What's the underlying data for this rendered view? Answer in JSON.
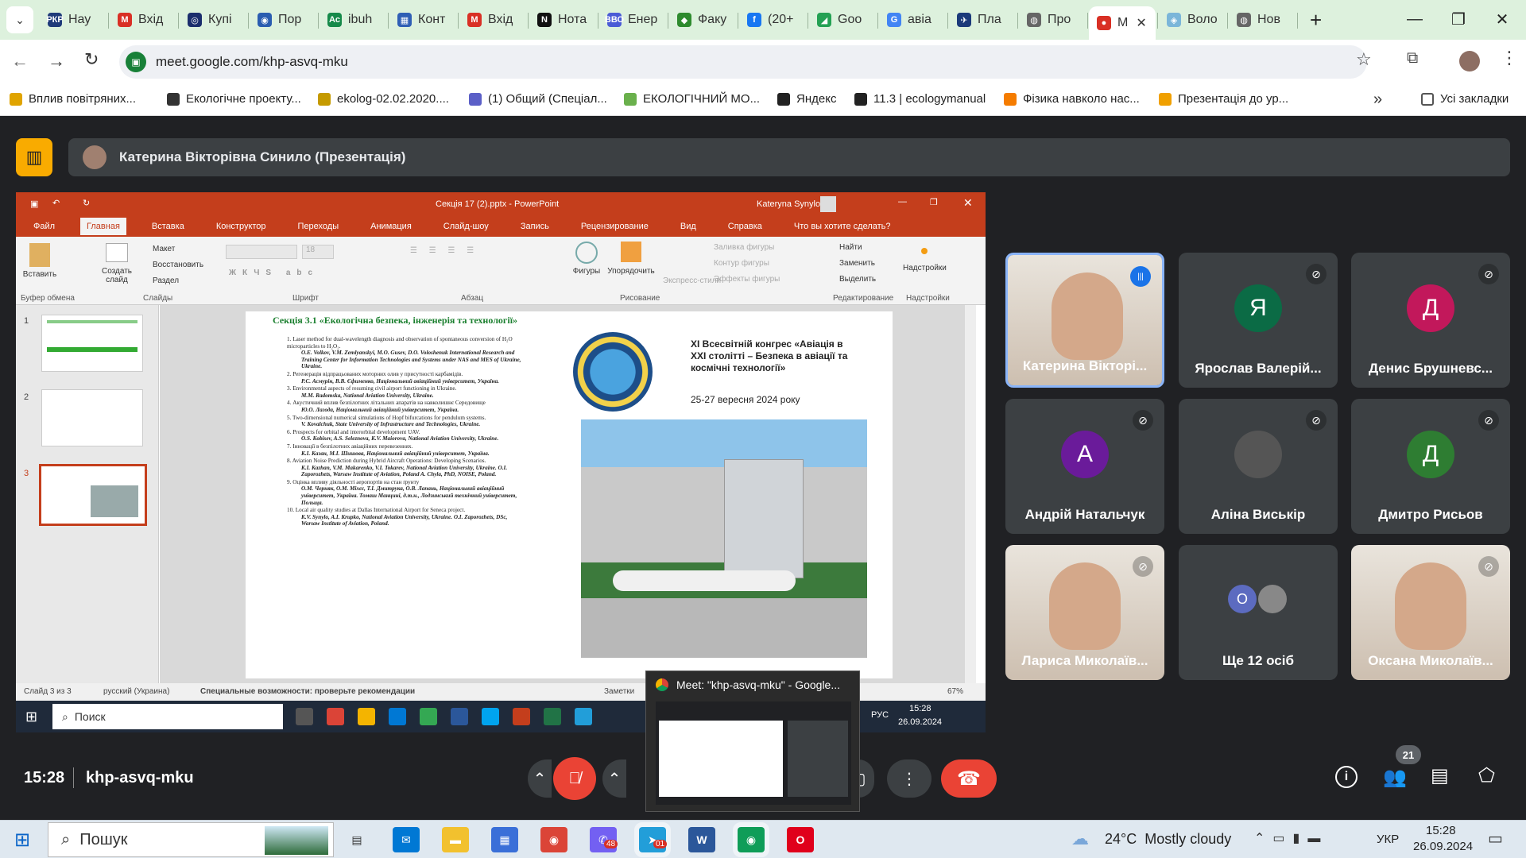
{
  "browser": {
    "tabs": [
      {
        "label": "Нау",
        "fav": "РКР",
        "color": "#1f3b7a"
      },
      {
        "label": "Вхід",
        "fav": "M",
        "color": "#d93025"
      },
      {
        "label": "Купі",
        "fav": "◎",
        "color": "#1b2e6d"
      },
      {
        "label": "Пор",
        "fav": "◉",
        "color": "#2a5db0"
      },
      {
        "label": "ibuh",
        "fav": "Ac",
        "color": "#168a4a"
      },
      {
        "label": "Конт",
        "fav": "▦",
        "color": "#2f5fb5"
      },
      {
        "label": "Вхід",
        "fav": "M",
        "color": "#d93025"
      },
      {
        "label": "Нота",
        "fav": "N",
        "color": "#111"
      },
      {
        "label": "Енер",
        "fav": "ВВО",
        "color": "#4a5bd6"
      },
      {
        "label": "Факу",
        "fav": "◆",
        "color": "#2e8b2e"
      },
      {
        "label": "(20+",
        "fav": "f",
        "color": "#1877f2"
      },
      {
        "label": "Goo",
        "fav": "◢",
        "color": "#24a153"
      },
      {
        "label": "авіа",
        "fav": "G",
        "color": "#4285f4"
      },
      {
        "label": "Пла",
        "fav": "✈",
        "color": "#1b3a7a"
      },
      {
        "label": "Про",
        "fav": "◍",
        "color": "#666"
      },
      {
        "label": "M",
        "fav": "●",
        "color": "#d93025"
      },
      {
        "label": "Воло",
        "fav": "◈",
        "color": "#7bb6d9"
      },
      {
        "label": "Нов",
        "fav": "◍",
        "color": "#666"
      }
    ],
    "url": "meet.google.com/khp-asvq-mku",
    "bookmarks": [
      {
        "label": "Вплив повітряних...",
        "color": "#e0a400"
      },
      {
        "label": "Екологічне проекту...",
        "color": "#333"
      },
      {
        "label": "ekolog-02.02.2020....",
        "color": "#c59a00"
      },
      {
        "label": "(1) Общий (Спеціал...",
        "color": "#5b5fc7"
      },
      {
        "label": "ЕКОЛОГІЧНИЙ МО...",
        "color": "#6ab04c"
      },
      {
        "label": "Яндекс",
        "color": "#222"
      },
      {
        "label": "11.3 | ecologymanual",
        "color": "#222"
      },
      {
        "label": "Фізика навколо нас...",
        "color": "#f57c00"
      },
      {
        "label": "Презентація до ур...",
        "color": "#f0a000"
      }
    ],
    "all_bookmarks": "Усі закладки",
    "more": "»"
  },
  "meet": {
    "presenter": "Катерина Вікторівна Синило (Презентація)",
    "time": "15:28",
    "code": "khp-asvq-mku",
    "people_count": "21",
    "participants": [
      {
        "name": "Катерина Вікторі...",
        "type": "video",
        "speaking": true
      },
      {
        "name": "Ярослав Валерій...",
        "type": "avatar",
        "letter": "Я",
        "color": "#0b6b45"
      },
      {
        "name": "Денис Брушневс...",
        "type": "avatar",
        "letter": "Д",
        "color": "#c2185b"
      },
      {
        "name": "Андрій Натальчук",
        "type": "avatar",
        "letter": "А",
        "color": "#6a1b9a"
      },
      {
        "name": "Аліна Виськір",
        "type": "photo",
        "letter": "",
        "color": "#555"
      },
      {
        "name": "Дмитро Рисьов",
        "type": "avatar",
        "letter": "Д",
        "color": "#2e7d32"
      },
      {
        "name": "Лариса Миколаїв...",
        "type": "video",
        "speaking": false
      },
      {
        "name": "Ще 12 осіб",
        "type": "more",
        "letter": "О",
        "color": "#5c6bc0"
      },
      {
        "name": "Оксана Миколаїв...",
        "type": "video",
        "speaking": false
      }
    ],
    "popup_title": "Meet: \"khp-asvq-mku\" - Google..."
  },
  "ppt": {
    "title": "Секція 17 (2).pptx - PowerPoint",
    "user": "Kateryna Synylo",
    "menu": [
      "Файл",
      "Главная",
      "Вставка",
      "Конструктор",
      "Переходы",
      "Анимация",
      "Слайд-шоу",
      "Запись",
      "Рецензирование",
      "Вид",
      "Справка",
      "Что вы хотите сделать?"
    ],
    "groups": [
      "Буфер обмена",
      "Слайды",
      "Шрифт",
      "Абзац",
      "Рисование",
      "Редактирование",
      "Надстройки"
    ],
    "ribbon": {
      "paste": "Вставить",
      "create": "Создать слайд",
      "layout": "Макет",
      "restore": "Восстановить",
      "section": "Раздел",
      "shapes": "Фигуры",
      "arrange": "Упорядочить",
      "styles": "Экспресс-стили",
      "fill": "Заливка фигуры",
      "outline": "Контур фигуры",
      "effects": "Эффекты фигуры",
      "find": "Найти",
      "replace": "Заменить",
      "select": "Выделить",
      "addins": "Надстройки"
    },
    "slide": {
      "section": "Секція 3.1 «Екологічна безпека, інженерія та технології»",
      "congress": "XI Всесвітній конгрес «Авіація в ХХІ столітті – Безпека в авіації та космічні технології»",
      "dates": "25-27 вересня 2024 року",
      "items": [
        "1. Laser method for dual-wavelength diagnosis and observation of spontaneous conversion of H₂O microparticles to H₂O₂.",
        "O.E. Volkov, V.M. Zemlyanskyi, M.O. Gusev, D.O. Voloshenuk International Research and Training Center for Information Technologies and Systems under NAS and MES of Ukraine, Ukraine.",
        "2. Регенерація відпрацьованих моторних олив у присутності карбамідів.",
        "Р.С. Асмурін, В.В. Єфименко, Національний авіаційний університет, Україна.",
        "3. Environmental aspects of resuming civil airport functioning in Ukraine.",
        "M.M. Radomska, National Aviation University, Ukraine.",
        "4. Акустичний вплив безпілотних літальних апаратів на навколишнє Середовище",
        "Ю.О. Лагода, Національний авіаційний університет, Україна.",
        "5. Two-dimensional numerical simulations of Hopf bifurcations for pendulum systems.",
        "V. Kovalchuk, State University of Infrastructure and Technologies, Ukraine.",
        "6. Prospects for orbital and interorbital development UAV.",
        "O.S. Kobisev, A.S. Seleznova, K.V. Maiorova, National Aviation University, Ukraine.",
        "7. Інновації в безпілотних авіаційних перевезеннях.",
        "К.І. Казан, М.І. Шишова, Національний авіаційний університет, Україна.",
        "8. Aviation Noise Prediction during Hybrid Aircraft Operations: Developing Scenarios.",
        "K.I. Kazhan, V.M. Makarenko, V.I. Tokarev, National Aviation University, Ukraine. O.I. Zaporozhets, Warsaw Institute of Aviation, Poland A. Chyla, PhD, NOISE, Poland.",
        "9. Оцінка впливу діяльності аеропортів на стан ґрунту",
        "О.М. Черняк, О.М. Міхєє, Т.І. Дмитрука, О.В. Лапань, Національний авіаційний університет, Україна. Томаш Манцині, д.т.н., Лодзинський технічний університет, Польща.",
        "10. Local air quality studies at Dallas International Airport for Seneca project.",
        "K.V. Synylo, A.I. Krupko, National Aviation University, Ukraine. O.I. Zaporozhets, DSc, Warsaw Institute of Aviation, Poland."
      ]
    },
    "status": {
      "slide": "Слайд 3 из 3",
      "lang": "русский (Украина)",
      "access": "Специальные возможности: проверьте рекомендации",
      "notes": "Заметки",
      "zoom": "67%"
    },
    "inner_taskbar": {
      "search": "Поиск",
      "lang": "РУС",
      "time": "15:28",
      "date": "26.09.2024"
    }
  },
  "taskbar": {
    "search": "Пошук",
    "weather": "24°C  Mostly cloudy",
    "lang": "УКР",
    "time": "15:28",
    "date": "26.09.2024",
    "badge_viber": "48",
    "badge_tg": "01"
  }
}
